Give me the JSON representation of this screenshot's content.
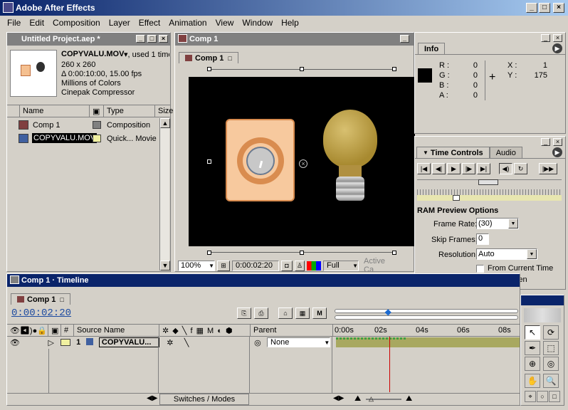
{
  "app": {
    "title": "Adobe After Effects"
  },
  "menu": [
    "File",
    "Edit",
    "Composition",
    "Layer",
    "Effect",
    "Animation",
    "View",
    "Window",
    "Help"
  ],
  "project": {
    "title": "Untitled Project.aep *",
    "selected_file": "COPYVALU.MOV",
    "used_text": "▾, used 1 time",
    "info_lines": [
      "260 x 260",
      "Δ 0:00:10:00, 15.00 fps",
      "Millions of Colors",
      "Cinepak Compressor"
    ],
    "columns": [
      "Name",
      "Type",
      "Size"
    ],
    "items": [
      {
        "name": "Comp 1",
        "type": "Composition"
      },
      {
        "name": "COPYVALU.MOV",
        "type": "Quick... Movie"
      }
    ]
  },
  "comp": {
    "title": "Comp 1",
    "tab": "Comp 1",
    "zoom": "100%",
    "timecode": "0:00:02:20",
    "resolution": "Full",
    "camera": "Active Ca"
  },
  "info": {
    "tab": "Info",
    "r_label": "R :",
    "r_value": "0",
    "g_label": "G :",
    "g_value": "0",
    "b_label": "B :",
    "b_value": "0",
    "a_label": "A :",
    "a_value": "0",
    "x_label": "X :",
    "x_value": "1",
    "y_label": "Y :",
    "y_value": "175"
  },
  "time_controls": {
    "tab": "Time Controls",
    "tab2": "Audio",
    "ram_title": "RAM Preview Options",
    "frame_rate_label": "Frame Rate:",
    "frame_rate_value": "(30)",
    "skip_frames_label": "Skip Frames:",
    "skip_frames_value": "0",
    "resolution_label": "Resolution:",
    "resolution_value": "Auto",
    "from_current_time": "From Current Time",
    "full_screen": "Full Screen"
  },
  "timeline": {
    "title": "Comp 1 · Timeline",
    "tab": "Comp 1",
    "timecode": "0:00:02:20",
    "columns": {
      "number": "#",
      "source_name": "Source Name",
      "parent": "Parent"
    },
    "ticks": [
      "0:00s",
      "02s",
      "04s",
      "06s",
      "08s"
    ],
    "layer": {
      "number": "1",
      "name": "COPYVALU...",
      "parent": "None"
    },
    "switches_label": "Switches / Modes",
    "playhead_seconds": 2.93,
    "duration_seconds": 10
  },
  "colors": {
    "title_active": "#0a246a",
    "comp_label": "#808080",
    "movie_label": "#f0f0a0",
    "playhead": "#cc0000",
    "layer_bar": "#a8a860"
  }
}
